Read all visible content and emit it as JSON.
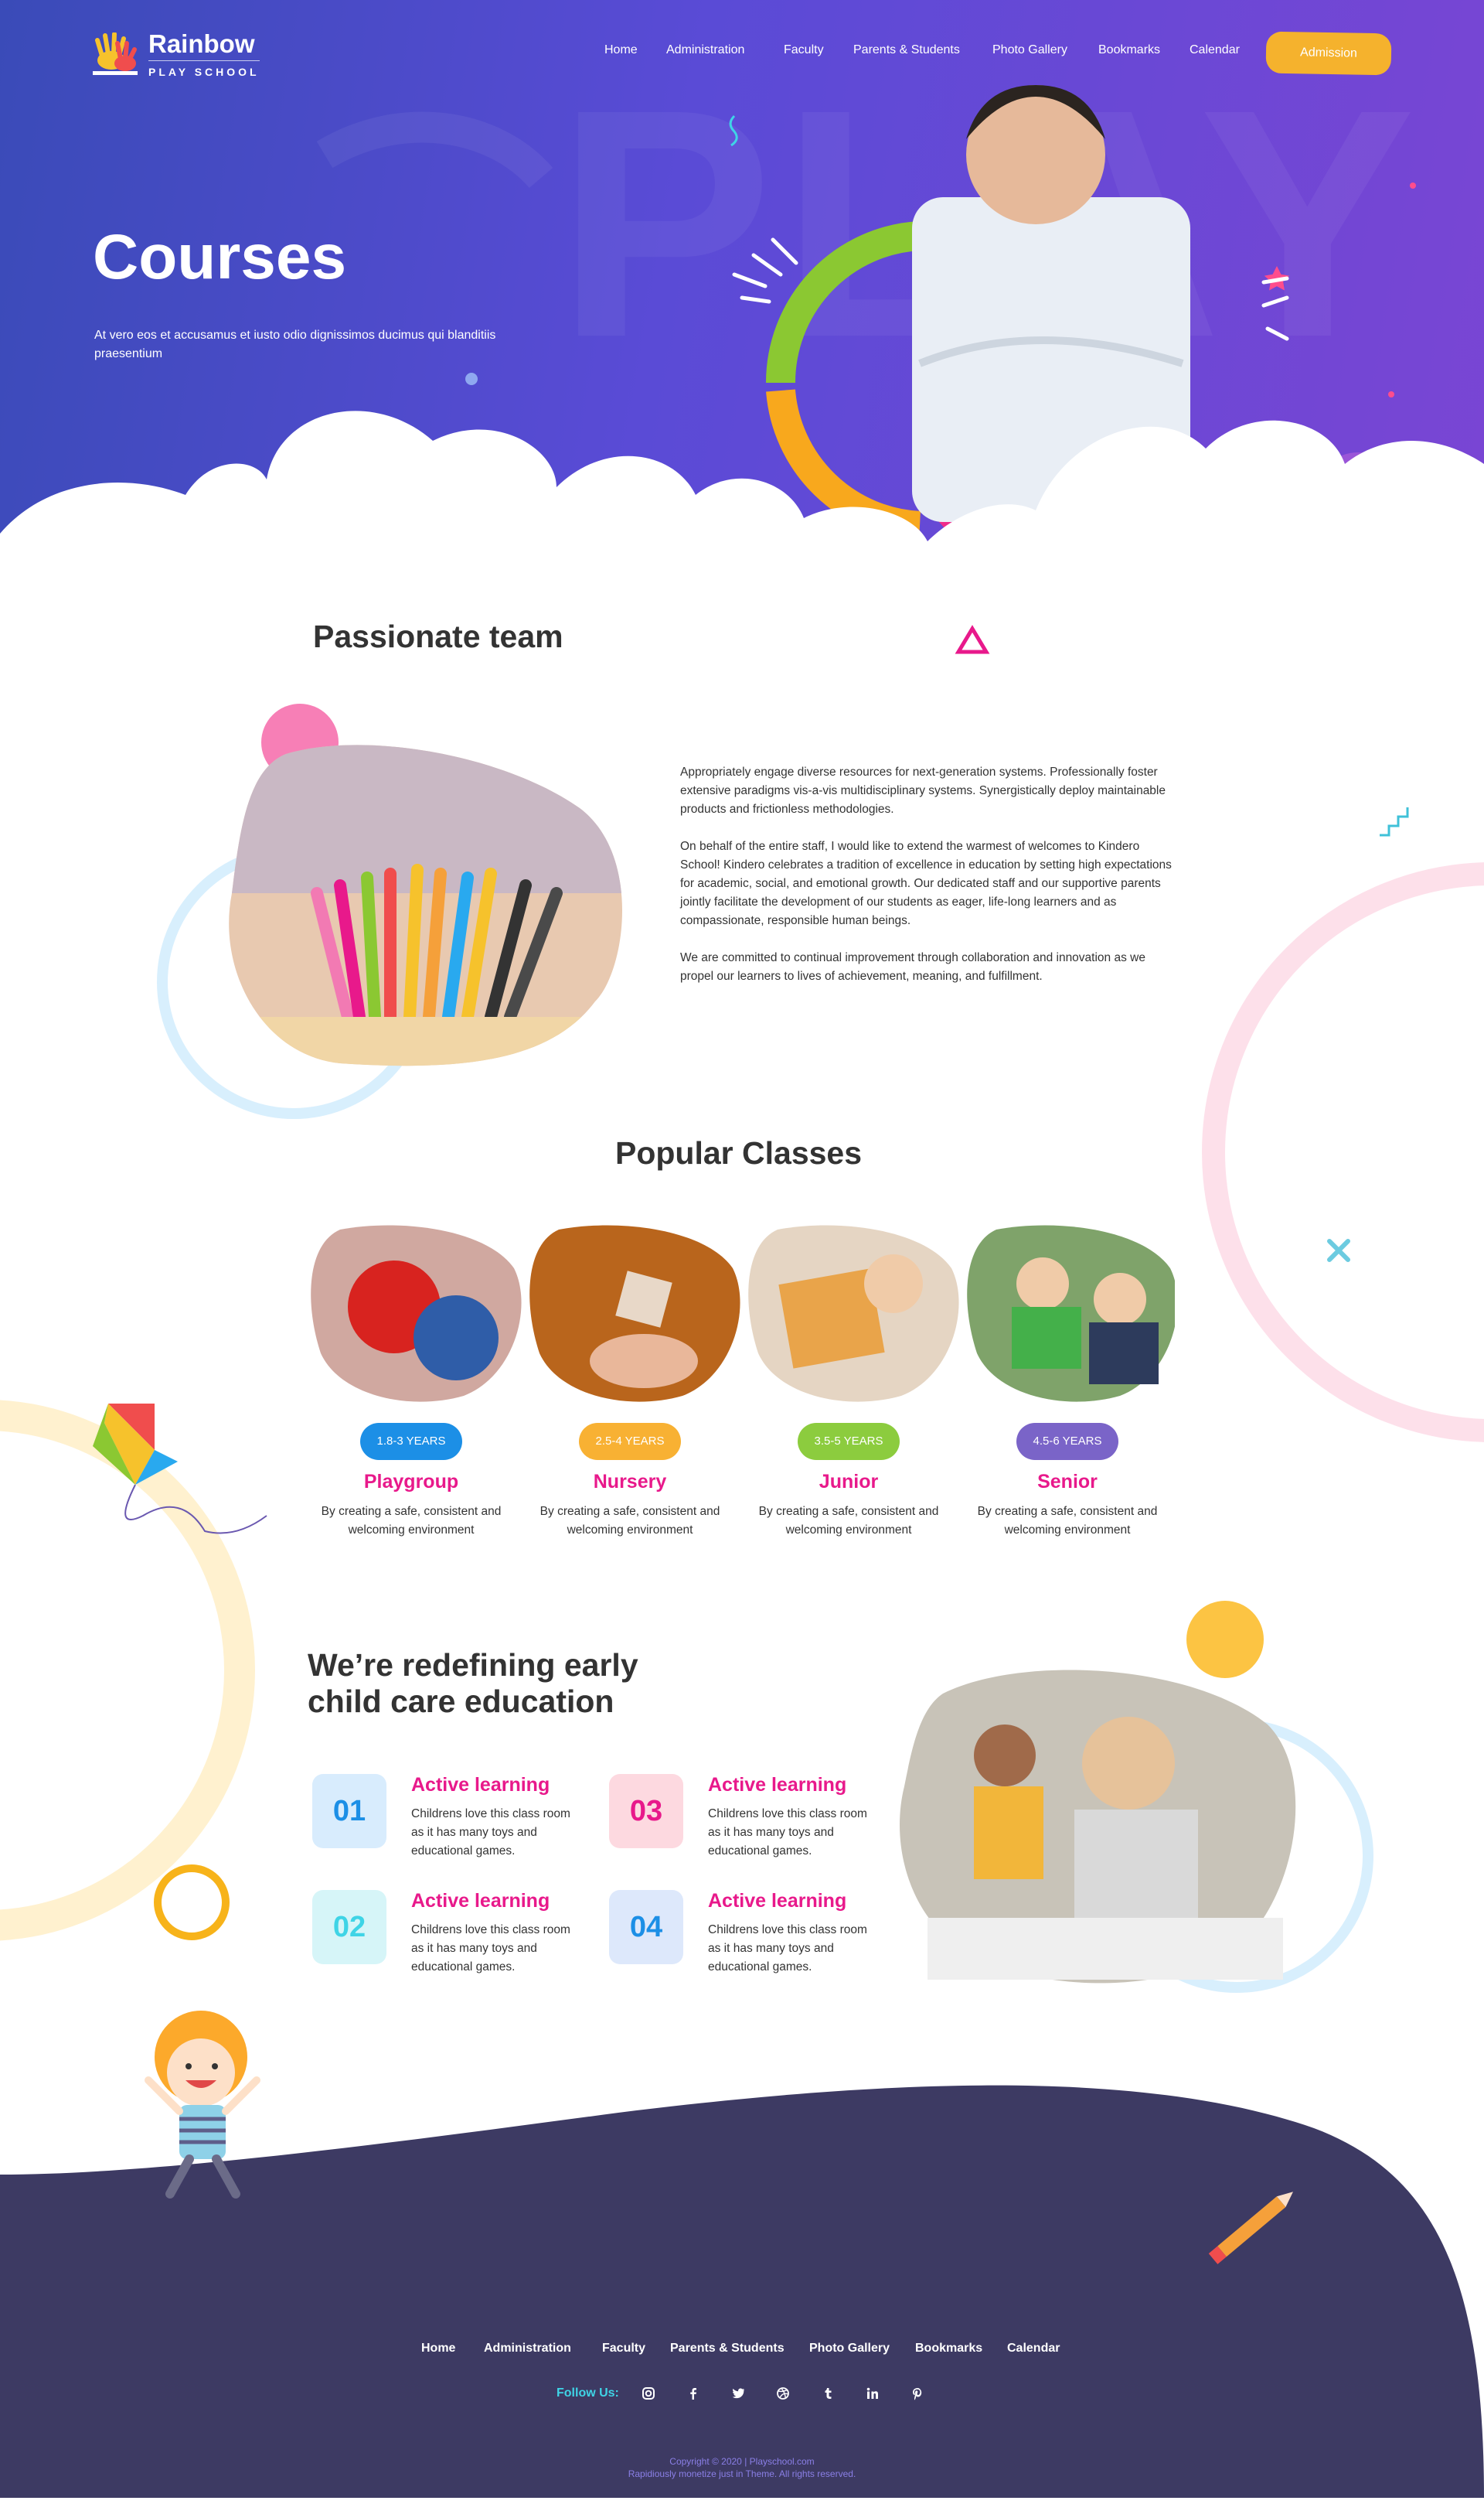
{
  "brand": {
    "name": "Rainbow",
    "sub": "PLAY SCHOOL"
  },
  "nav": [
    "Home",
    "Administration",
    "Faculty",
    "Parents & Students",
    "Photo Gallery",
    "Bookmarks",
    "Calendar"
  ],
  "admission_label": "Admission",
  "hero": {
    "bg_text": "PLAY",
    "title": "Courses",
    "desc": "At vero eos et accusamus et iusto odio dignissimos ducimus qui blanditiis praesentium"
  },
  "team": {
    "title": "Passionate team",
    "paragraphs": [
      "Appropriately engage diverse resources for next-generation systems. Professionally foster extensive paradigms vis-a-vis multidisciplinary systems. Synergistically deploy maintainable products and frictionless methodologies.",
      "On behalf of the entire staff, I would like to extend the warmest of welcomes to Kindero School! Kindero celebrates a tradition of excellence in education by setting high expectations for academic, social, and emotional growth. Our dedicated staff and our supportive parents jointly facilitate the development of our students as eager, life-long learners and as compassionate, responsible human beings.",
      "We are committed to continual improvement through collaboration and innovation as we propel our learners to lives of achievement, meaning, and fulfillment."
    ]
  },
  "classes": {
    "title": "Popular Classes",
    "items": [
      {
        "badge": "1.8-3 YEARS",
        "name": "Playgroup",
        "desc": "By creating a safe, consistent and welcoming environment",
        "color": "#1c8fe6"
      },
      {
        "badge": "2.5-4 YEARS",
        "name": "Nursery",
        "desc": "By creating a safe, consistent and welcoming environment",
        "color": "#f8b133"
      },
      {
        "badge": "3.5-5 YEARS",
        "name": "Junior",
        "desc": "By creating a safe, consistent and welcoming environment",
        "color": "#8ccc3e"
      },
      {
        "badge": "4.5-6 YEARS",
        "name": "Senior",
        "desc": "By creating a safe, consistent and welcoming environment",
        "color": "#7a64c8"
      }
    ]
  },
  "redefine": {
    "title_line1": "We’re redefining early",
    "title_line2": "child care education",
    "features": [
      {
        "num": "01",
        "title": "Active learning",
        "desc": "Childrens love this class room as it has many toys and educational games.",
        "bg": "#d8ecfd",
        "fg": "#1c8fe6"
      },
      {
        "num": "03",
        "title": "Active learning",
        "desc": "Childrens love this class room as it has many toys and educational games.",
        "bg": "#fdd9e0",
        "fg": "#e8198b"
      },
      {
        "num": "02",
        "title": "Active learning",
        "desc": "Childrens love this class room as it has many toys and educational games.",
        "bg": "#d6f5f8",
        "fg": "#3fd4e6"
      },
      {
        "num": "04",
        "title": "Active learning",
        "desc": "Childrens love this class room as it has many toys and educational games.",
        "bg": "#dde8fb",
        "fg": "#1c8fe6"
      }
    ]
  },
  "footer": {
    "nav": [
      "Home",
      "Administration",
      "Faculty",
      "Parents & Students",
      "Photo Gallery",
      "Bookmarks",
      "Calendar"
    ],
    "follow_label": "Follow Us:",
    "social_icons": [
      "instagram-icon",
      "facebook-icon",
      "twitter-icon",
      "dribbble-icon",
      "tumblr-icon",
      "linkedin-icon",
      "pinterest-icon"
    ],
    "copyright_line1": "Copyright © 2020 | Playschool.com",
    "copyright_line2": "Rapidiously monetize just in Theme. All rights reserved."
  },
  "colors": {
    "hero_start": "#3a4bb8",
    "hero_end": "#7a45d4",
    "accent_pink": "#e8198b",
    "admission": "#f5b22d",
    "footer_bg": "#3d3a63"
  }
}
